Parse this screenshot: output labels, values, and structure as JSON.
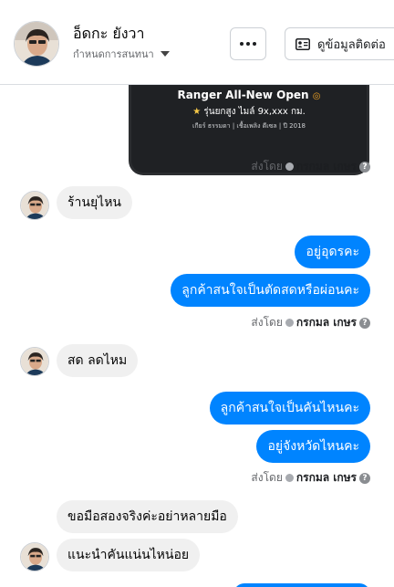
{
  "header": {
    "name": "อ็ดกะ ยังวา",
    "subtitle": "กำหนดการสนทนา",
    "contact_label": "ดูข้อมูลติดต่อ"
  },
  "card": {
    "title": "Ranger All-New Open",
    "subtitle": "รุ่นยกสูง ไมล์ 9x,xxx กม.",
    "meta": "เกียร์ ธรรมดา  |  เชื้อเพลิง ดีเซล  |  ปี 2018"
  },
  "sent_by": {
    "prefix": "ส่งโดย",
    "name": "กรกมล เกษร"
  },
  "messages": [
    {
      "side": "in",
      "text": "ร้านยุไหน"
    },
    {
      "side": "out",
      "text": "อยู่อุดรคะ"
    },
    {
      "side": "out",
      "text": "ลูกค้าสนใจเป็นตัดสดหรือผ่อนคะ"
    },
    {
      "side": "in",
      "text": "สด ลดไหม"
    },
    {
      "side": "out",
      "text": "ลูกค้าสนใจเป็นคันไหนคะ"
    },
    {
      "side": "out",
      "text": "อยู่จังหวัดไหนคะ"
    },
    {
      "side": "in",
      "text": "ขอมือสองจริงค่ะอย่าหลายมือ"
    },
    {
      "side": "in",
      "text": "แนะนำคันแน่นไหน่อย"
    }
  ],
  "colors": {
    "outgoing_bubble": "#0084ff",
    "incoming_bubble": "#f0f0f0"
  }
}
